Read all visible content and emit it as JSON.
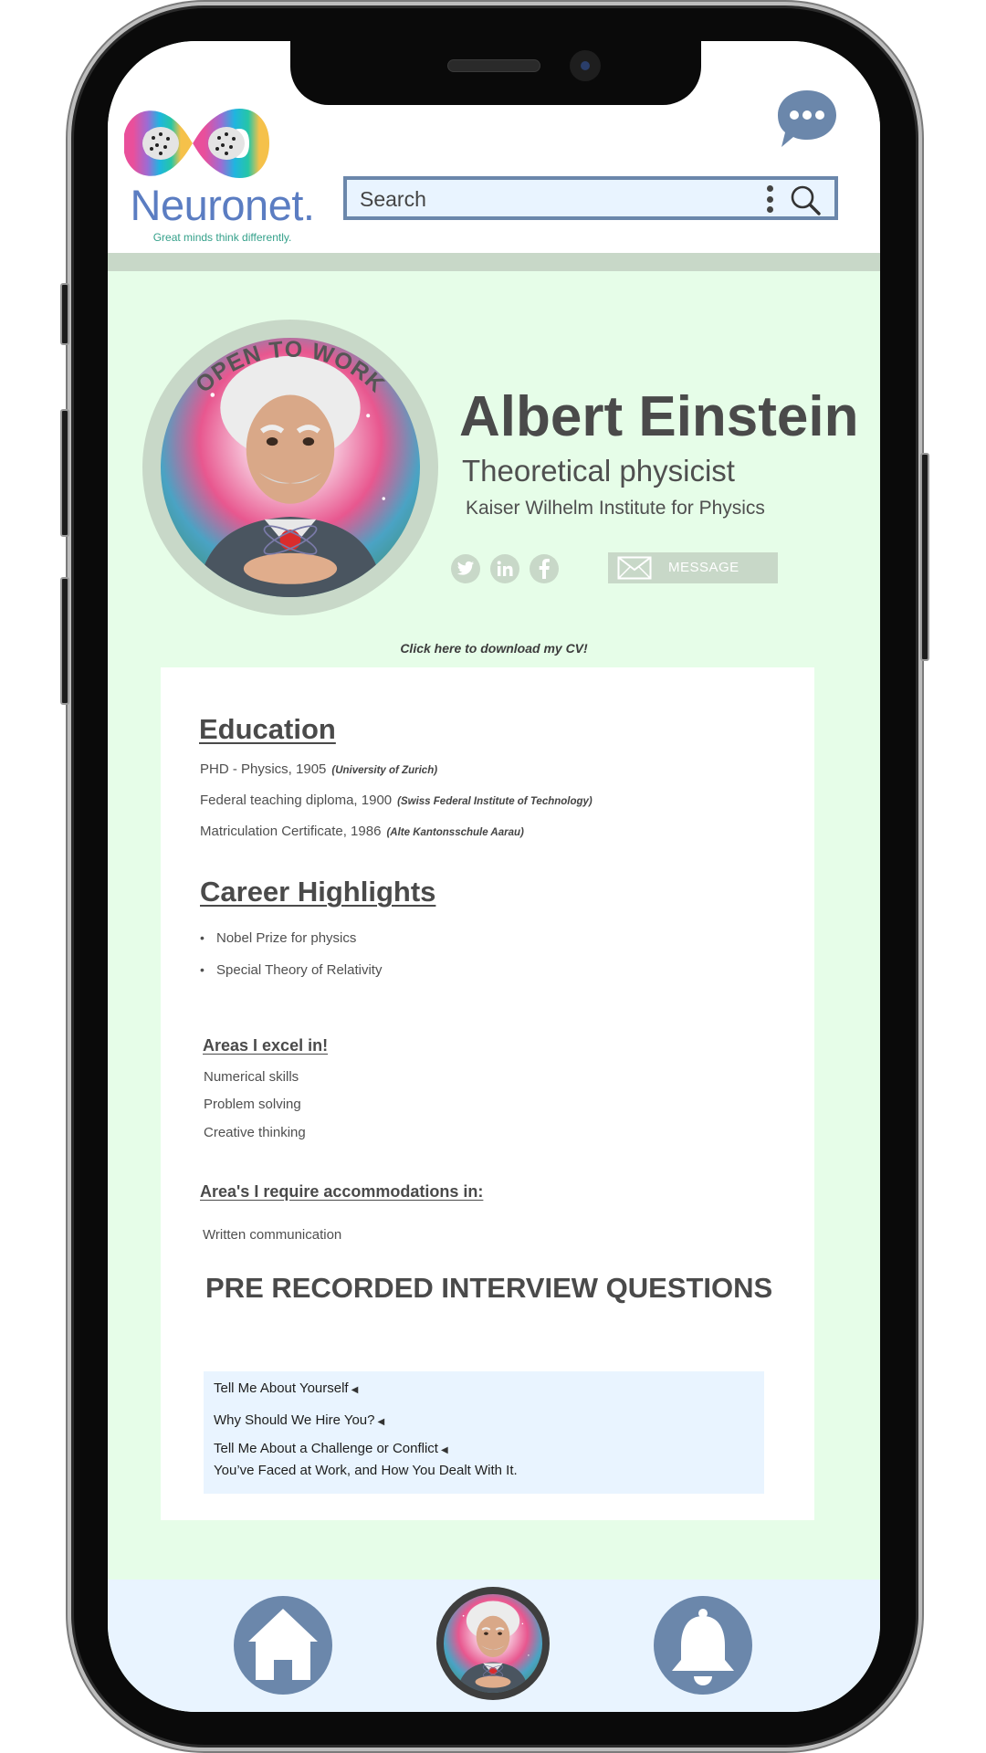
{
  "brand": {
    "name": "Neuronet.",
    "tagline": "Great minds think differently."
  },
  "search": {
    "placeholder": "Search"
  },
  "profile": {
    "badge": "OPEN TO WORK",
    "name": "Albert Einstein",
    "title": "Theoretical physicist",
    "organization": "Kaiser Wilhelm Institute for Physics",
    "message_label": "MESSAGE",
    "cv_link": "Click here to download my CV!",
    "social": [
      "twitter-icon",
      "linkedin-icon",
      "facebook-icon"
    ]
  },
  "education": {
    "heading": "Education",
    "items": [
      {
        "text": "PHD - Physics, 1905",
        "institution": "(University of Zurich)"
      },
      {
        "text": "Federal teaching diploma, 1900",
        "institution": "(Swiss Federal Institute of Technology)"
      },
      {
        "text": "Matriculation Certificate, 1986",
        "institution": "(Alte Kantonsschule Aarau)"
      }
    ]
  },
  "career": {
    "heading": "Career Highlights",
    "items": [
      "Nobel Prize for physics",
      "Special Theory of Relativity"
    ]
  },
  "strengths": {
    "heading": "Areas I excel in!",
    "items": [
      "Numerical skills",
      "Problem solving",
      "Creative thinking"
    ]
  },
  "accommodations": {
    "heading": "Area's I require accommodations in:",
    "items": [
      "Written communication"
    ]
  },
  "interview": {
    "heading": "PRE RECORDED INTERVIEW QUESTIONS",
    "questions": [
      {
        "line1": "Tell Me About Yourself",
        "line2": ""
      },
      {
        "line1": "Why Should We Hire You?",
        "line2": ""
      },
      {
        "line1": "Tell Me About a Challenge or Conflict",
        "line2": "You’ve Faced at Work, and How You Dealt With It."
      }
    ]
  },
  "nav": {
    "items": [
      "home-icon",
      "profile-avatar",
      "bell-icon"
    ]
  },
  "colors": {
    "page_bg": "#e6fde8",
    "accent_green": "#c8d8c8",
    "nav_blue": "#6b87ab",
    "search_bg": "#e9f4ff",
    "brand_blue": "#5b7dc2"
  }
}
